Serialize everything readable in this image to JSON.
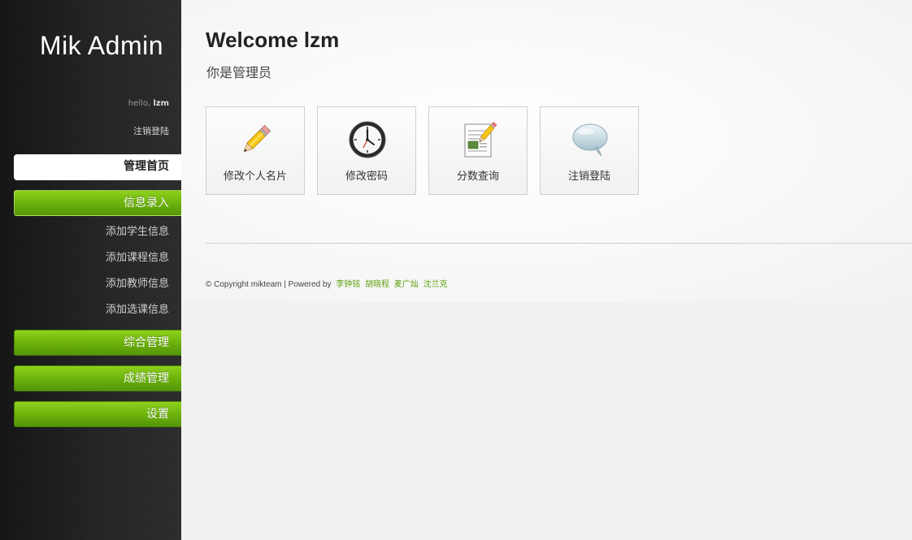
{
  "sidebar": {
    "logo": "Mik Admin",
    "greeting": "hello,",
    "username": "lzm",
    "logout": "注销登陆",
    "nav": {
      "home": "管理首页",
      "info_entry": "信息录入",
      "comprehensive": "综合管理",
      "grades": "成绩管理",
      "settings": "设置"
    },
    "sub_items": [
      "添加学生信息",
      "添加课程信息",
      "添加教师信息",
      "添加选课信息"
    ]
  },
  "main": {
    "welcome": "Welcome lzm",
    "role": "你是管理员",
    "tiles": [
      {
        "label": "修改个人名片",
        "icon": "pencil-icon"
      },
      {
        "label": "修改密码",
        "icon": "clock-icon"
      },
      {
        "label": "分数查询",
        "icon": "notepad-icon"
      },
      {
        "label": "注销登陆",
        "icon": "speech-bubble-icon"
      }
    ]
  },
  "footer": {
    "copyright": "© Copyright mikteam | Powered by",
    "authors": [
      "李钟铭",
      "胡晓程",
      "麦广灿",
      "沈兰克"
    ]
  },
  "colors": {
    "accent_green": "#6cb30b",
    "sidebar_dark": "#242424",
    "link_green": "#5fa010"
  }
}
